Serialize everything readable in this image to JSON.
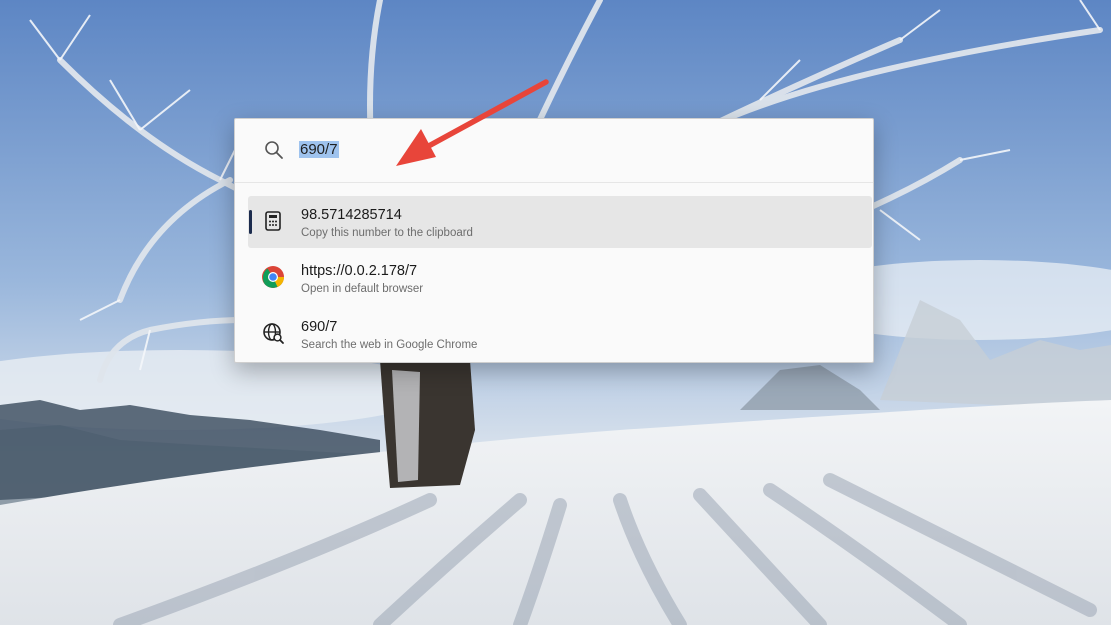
{
  "search": {
    "value": "690/7",
    "icon": "search-icon"
  },
  "results": [
    {
      "title": "98.5714285714",
      "subtitle": "Copy this number to the clipboard",
      "icon": "calculator-icon",
      "selected": true
    },
    {
      "title": "https://0.0.2.178/7",
      "subtitle": "Open in default browser",
      "icon": "chrome-icon",
      "selected": false
    },
    {
      "title": "690/7",
      "subtitle": "Search the web in Google Chrome",
      "icon": "web-search-icon",
      "selected": false
    }
  ],
  "colors": {
    "selected_bg": "#e6e6e6",
    "selection_highlight": "#9fc3ee",
    "annotation_arrow": "#e8453a",
    "accent_bar": "#1b2b4d"
  }
}
